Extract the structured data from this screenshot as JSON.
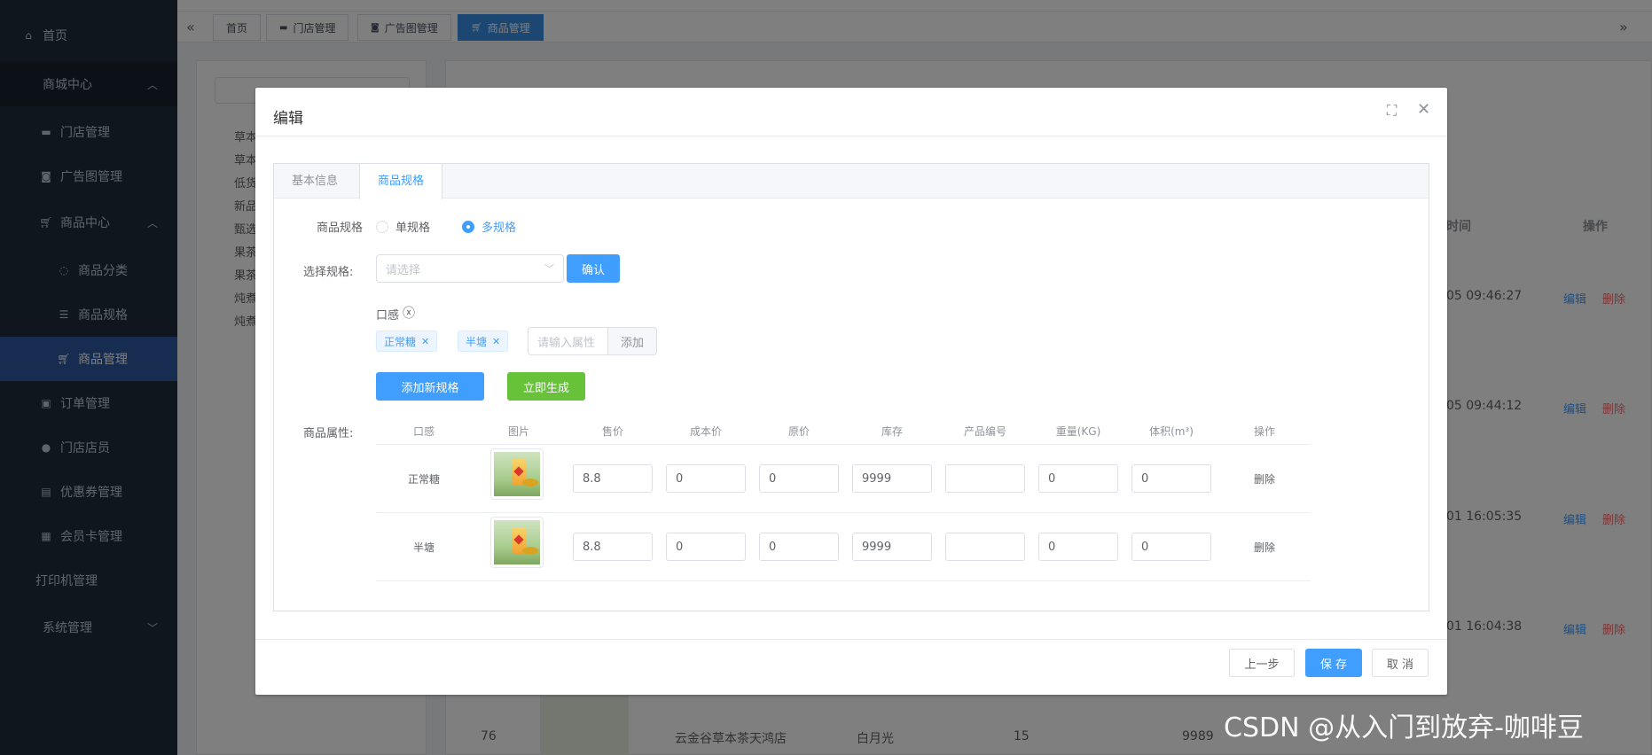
{
  "sidebar": {
    "home": "首页",
    "mall_center": "商城中心",
    "store_manage": "门店管理",
    "ad_manage": "广告图管理",
    "goods_center": "商品中心",
    "goods_category": "商品分类",
    "goods_spec": "商品规格",
    "goods_manage": "商品管理",
    "order_manage": "订单管理",
    "store_staff": "门店店员",
    "coupon_manage": "优惠券管理",
    "member_card": "会员卡管理",
    "printer_manage": "打印机管理",
    "system_manage": "系统管理"
  },
  "tags": [
    "首页",
    "门店管理",
    "广告图管理",
    "商品管理"
  ],
  "background": {
    "tree_items": [
      "草本",
      "草本",
      "低货",
      "新品",
      "甄选",
      "果茶",
      "果茶",
      "炖煮",
      "炖煮"
    ],
    "col_time": "时间",
    "col_ops": "操作",
    "times": [
      "05 09:46:27",
      "05 09:44:12",
      "01 16:05:35",
      "01 16:04:38"
    ],
    "edit": "编辑",
    "delete": "删除",
    "row_num": "76",
    "row_store": "云金谷草本茶天鸿店",
    "row_name": "白月光",
    "row_price": "15",
    "row_stock": "9989"
  },
  "dialog": {
    "title": "编辑",
    "tabs": [
      "基本信息",
      "商品规格"
    ],
    "spec_label": "商品规格",
    "single_spec": "单规格",
    "multi_spec": "多规格",
    "choose_spec_label": "选择规格:",
    "choose_placeholder": "请选择",
    "confirm": "确认",
    "attr_group": "口感",
    "chips": [
      "正常糖",
      "半塘"
    ],
    "attr_placeholder": "请输入属性",
    "attr_add": "添加",
    "add_new_spec": "添加新规格",
    "generate_now": "立即生成",
    "goods_attr_label": "商品属性:",
    "columns": [
      "口感",
      "图片",
      "售价",
      "成本价",
      "原价",
      "库存",
      "产品编号",
      "重量(KG)",
      "体积(m³)",
      "操作"
    ],
    "rows": [
      {
        "flavor": "正常糖",
        "price": "8.8",
        "cost": "0",
        "original": "0",
        "stock": "9999",
        "sku": "",
        "weight": "0",
        "volume": "0",
        "op": "删除"
      },
      {
        "flavor": "半塘",
        "price": "8.8",
        "cost": "0",
        "original": "0",
        "stock": "9999",
        "sku": "",
        "weight": "0",
        "volume": "0",
        "op": "删除"
      }
    ],
    "prev": "上一步",
    "save": "保 存",
    "cancel": "取 消"
  },
  "watermark": "CSDN @从入门到放弃-咖啡豆",
  "colors": {
    "primary": "#409eff",
    "success": "#67c23a",
    "sidebar_bg": "#1f2d3d",
    "danger": "#f56c6c"
  }
}
